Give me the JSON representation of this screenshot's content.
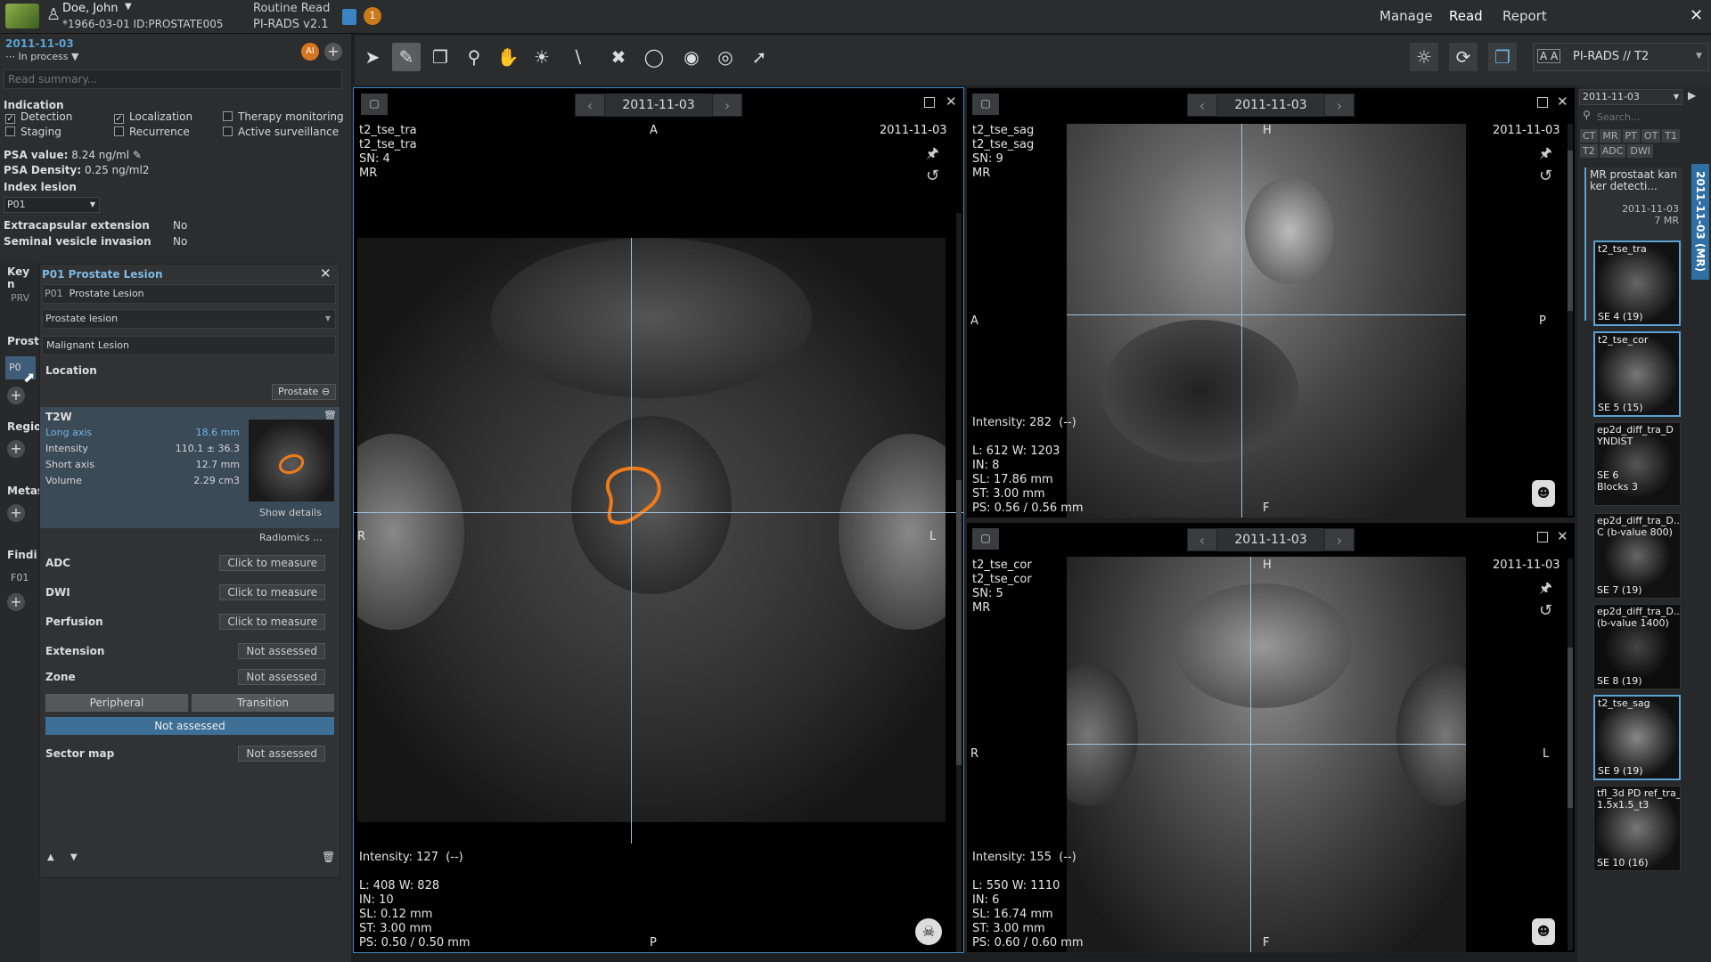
{
  "patient": {
    "name": "Doe, John",
    "dob_id": "*1966-03-01 ID:PROSTATE005",
    "read_type": "Routine Read",
    "protocol": "PI-RADS v2.1",
    "notif_count": "1"
  },
  "nav": {
    "manage": "Manage",
    "read": "Read",
    "report": "Report"
  },
  "study": {
    "date": "2011-11-03",
    "status": "In process",
    "summary_placeholder": "Read summary..."
  },
  "indication": {
    "title": "Indication",
    "items": [
      {
        "label": "Detection",
        "checked": true
      },
      {
        "label": "Localization",
        "checked": true
      },
      {
        "label": "Therapy monitoring",
        "checked": false
      },
      {
        "label": "Staging",
        "checked": false
      },
      {
        "label": "Recurrence",
        "checked": false
      },
      {
        "label": "Active surveillance",
        "checked": false
      }
    ]
  },
  "psa": {
    "value_label": "PSA value:",
    "value": "8.24 ng/ml",
    "density_label": "PSA Density:",
    "density": "0.25 ng/ml2"
  },
  "index_lesion": {
    "label": "Index lesion",
    "value": "P01"
  },
  "extracapsular": {
    "label": "Extracapsular extension",
    "value": "No"
  },
  "seminal": {
    "label": "Seminal vesicle invasion",
    "value": "No"
  },
  "side_tabs": {
    "key": "Key n",
    "prv": "PRV",
    "prost": "Prost",
    "p0": "P0",
    "regio": "Regio",
    "metas": "Metas",
    "findi": "Findi",
    "f01": "F01"
  },
  "lesion": {
    "title": "P01 Prostate Lesion",
    "id": "P01",
    "name": "Prostate Lesion",
    "type": "Prostate lesion",
    "classification": "Malignant Lesion",
    "location_label": "Location",
    "location_value": "Prostate",
    "t2w": {
      "label": "T2W",
      "long_axis_label": "Long axis",
      "long_axis": "18.6 mm",
      "intensity_label": "Intensity",
      "intensity": "110.1 ± 36.3",
      "short_axis_label": "Short axis",
      "short_axis": "12.7 mm",
      "volume_label": "Volume",
      "volume": "2.29 cm3",
      "show_details": "Show details",
      "radiomics": "Radiomics ..."
    },
    "adc": {
      "label": "ADC",
      "btn": "Click to measure"
    },
    "dwi": {
      "label": "DWI",
      "btn": "Click to measure"
    },
    "perfusion": {
      "label": "Perfusion",
      "btn": "Click to measure"
    },
    "extension": {
      "label": "Extension",
      "value": "Not assessed"
    },
    "zone": {
      "label": "Zone",
      "value": "Not assessed",
      "peripheral": "Peripheral",
      "transition": "Transition",
      "selected": "Not assessed"
    },
    "sector": {
      "label": "Sector map",
      "value": "Not assessed"
    }
  },
  "layout_label": "PI-RADS // T2",
  "viewports": {
    "main": {
      "date": "2011-11-03",
      "series1": "t2_tse_tra",
      "series2": "t2_tse_tra",
      "sn": "SN: 4",
      "mod": "MR",
      "corner_date": "2011-11-03",
      "orient_top": "A",
      "orient_bottom": "P",
      "orient_left": "R",
      "orient_right": "L",
      "intensity": "Intensity: 127  (--)",
      "lw": "L: 408 W: 828",
      "in": "IN: 10",
      "sl": "SL: 0.12 mm",
      "st": "ST: 3.00 mm",
      "ps": "PS: 0.50 / 0.50 mm"
    },
    "sag": {
      "date": "2011-11-03",
      "series1": "t2_tse_sag",
      "series2": "t2_tse_sag",
      "sn": "SN: 9",
      "mod": "MR",
      "corner_date": "2011-11-03",
      "orient_top": "H",
      "orient_bottom": "F",
      "orient_left": "A",
      "orient_right": "P",
      "intensity": "Intensity: 282  (--)",
      "lw": "L: 612 W: 1203",
      "in": "IN: 8",
      "sl": "SL: 17.86 mm",
      "st": "ST: 3.00 mm",
      "ps": "PS: 0.56 / 0.56 mm"
    },
    "cor": {
      "date": "2011-11-03",
      "series1": "t2_tse_cor",
      "series2": "t2_tse_cor",
      "sn": "SN: 5",
      "mod": "MR",
      "corner_date": "2011-11-03",
      "orient_top": "H",
      "orient_bottom": "F",
      "orient_left": "R",
      "orient_right": "L",
      "intensity": "Intensity: 155  (--)",
      "lw": "L: 550 W: 1110",
      "in": "IN: 6",
      "sl": "SL: 16.74 mm",
      "st": "ST: 3.00 mm",
      "ps": "PS: 0.60 / 0.60 mm"
    }
  },
  "series_panel": {
    "date": "2011-11-03",
    "search_placeholder": "Search...",
    "modalities": [
      "CT",
      "MR",
      "PT",
      "OT",
      "T1",
      "T2",
      "ADC",
      "DWI"
    ],
    "study_title": "MR prostaat kan ker detecti...",
    "study_date": "2011-11-03",
    "study_count": "7 MR",
    "vertical_tab": "2011-11-03 (MR)",
    "thumbs": [
      {
        "name": "t2_tse_tra",
        "se": "SE 4 (19)"
      },
      {
        "name": "t2_tse_cor",
        "se": "SE 5 (15)"
      },
      {
        "name": "ep2d_diff_tra_D\nYNDIST",
        "se": "SE 6\nBlocks 3"
      },
      {
        "name": "ep2d_diff_tra_D...\nC (b-value 800)",
        "se": "SE 7 (19)"
      },
      {
        "name": "ep2d_diff_tra_D...\n(b-value 1400)",
        "se": "SE 8 (19)"
      },
      {
        "name": "t2_tse_sag",
        "se": "SE 9 (19)"
      },
      {
        "name": "tfl_3d PD ref_tra_1\n1.5x1.5_t3",
        "se": "SE 10 (16)"
      }
    ]
  }
}
